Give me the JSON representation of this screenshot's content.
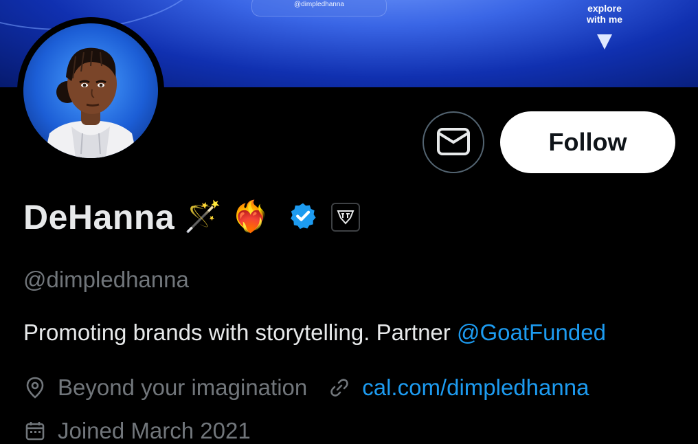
{
  "banner": {
    "handle_text": "@dimpledhanna",
    "cta_text_line1": "explore",
    "cta_text_line2": "with me"
  },
  "profile": {
    "display_name": "DeHanna",
    "name_emojis": [
      "🪄",
      "❤️‍🔥"
    ],
    "handle": "@dimpledhanna",
    "bio_text": "Promoting brands with storytelling. Partner ",
    "bio_mention": "@GoatFunded",
    "location": "Beyond your imagination",
    "website": "cal.com/dimpledhanna",
    "joined": "Joined March 2021"
  },
  "actions": {
    "follow_label": "Follow"
  },
  "icons": {
    "message": "envelope-icon",
    "verified": "verified-badge-icon",
    "affiliate": "affiliate-badge-icon",
    "location": "location-pin-icon",
    "link": "link-icon",
    "calendar": "calendar-icon"
  },
  "colors": {
    "background": "#000000",
    "primary_text": "#e7e9ea",
    "secondary_text": "#71767b",
    "accent_blue": "#1d9bf0",
    "follow_bg": "#ffffff"
  }
}
